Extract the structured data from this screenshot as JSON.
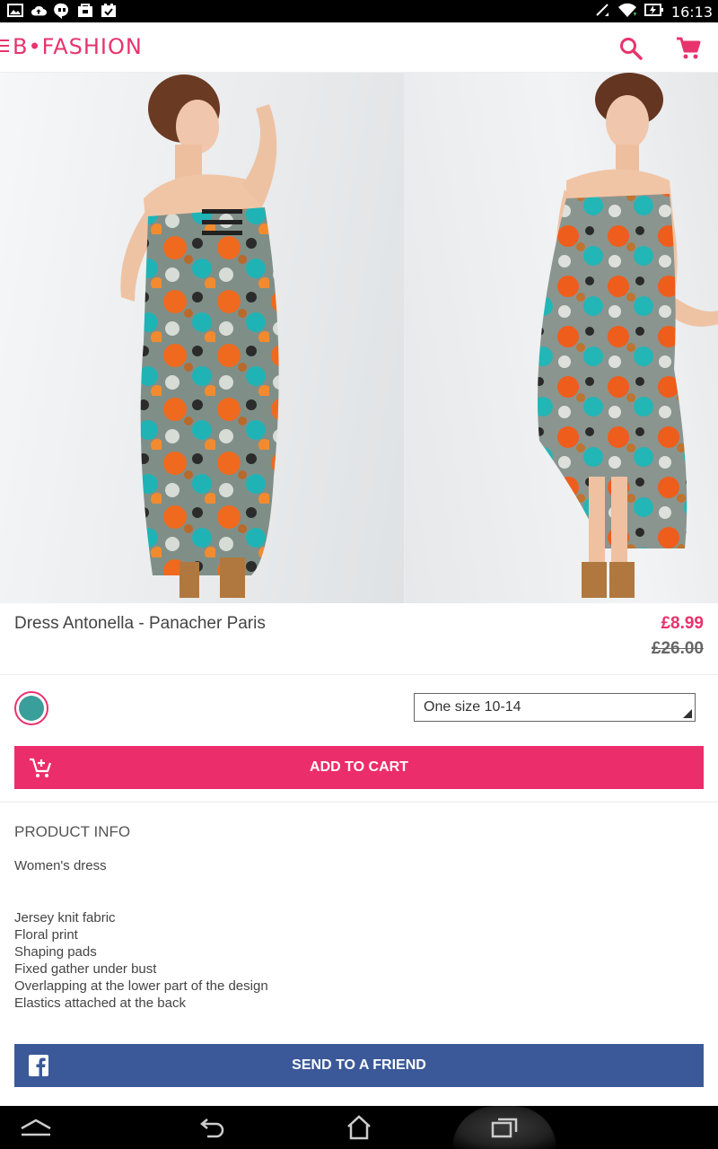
{
  "status_bar": {
    "time": "16:13",
    "left_icons": [
      "image-icon",
      "cloud-upload-icon",
      "hangouts-icon",
      "shopping-bag-icon",
      "task-check-icon"
    ],
    "right_icons": [
      "mute-icon",
      "wifi-icon",
      "battery-charging-icon"
    ]
  },
  "header": {
    "logo": "B•FASHION",
    "icons": [
      "menu-icon",
      "search-icon",
      "cart-icon"
    ]
  },
  "colors": {
    "accent": "#ec2d6b",
    "facebook": "#3b5998",
    "swatch": "#3a9e9b"
  },
  "product": {
    "name": "Dress Antonella - Panacher Paris",
    "price": "£8.99",
    "old_price": "£26.00",
    "images": [
      "back-view-photo",
      "front-view-photo"
    ]
  },
  "options": {
    "size_selected": "One size 10-14",
    "add_to_cart": "ADD TO CART"
  },
  "info": {
    "heading": "PRODUCT INFO",
    "subtitle": "Women's dress",
    "features": [
      "Jersey knit fabric",
      "Floral print",
      "Shaping pads",
      "Fixed gather under bust",
      "Overlapping at the lower part of the design",
      "Elastics attached at the back"
    ]
  },
  "share": {
    "send_to_friend": "SEND TO A FRIEND"
  },
  "nav_bar": {
    "icons": [
      "collapse-up-icon",
      "back-icon",
      "home-icon",
      "recent-apps-icon"
    ]
  }
}
